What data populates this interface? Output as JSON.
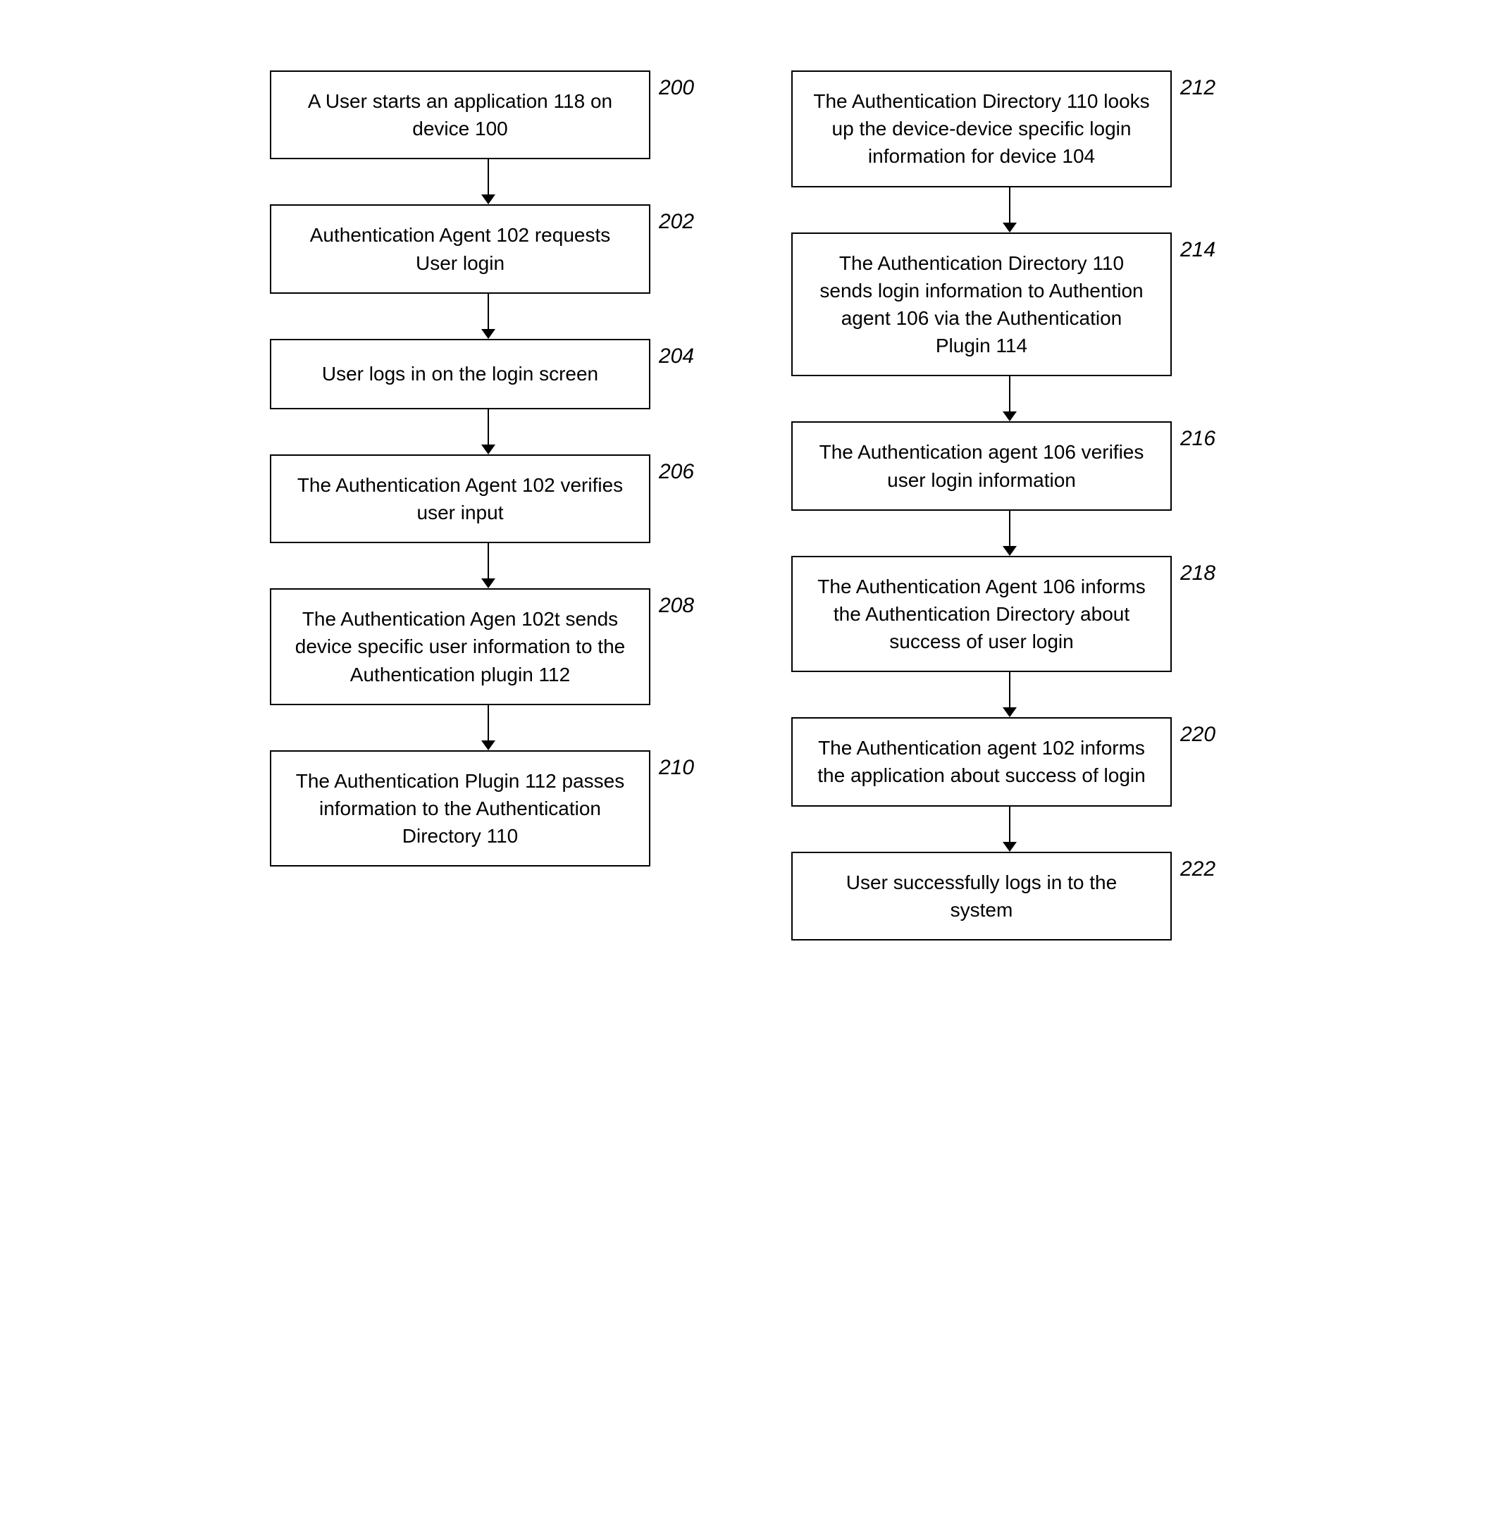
{
  "left_column": {
    "steps": [
      {
        "id": "200",
        "text": "A User starts an application 118 on device 100",
        "label": "200"
      },
      {
        "id": "202",
        "text": "Authentication Agent 102 requests User login",
        "label": "202"
      },
      {
        "id": "204",
        "text": "User logs in on the login screen",
        "label": "204"
      },
      {
        "id": "206",
        "text": "The Authentication Agent 102 verifies user input",
        "label": "206"
      },
      {
        "id": "208",
        "text": "The Authentication Agen 102t sends device specific user information to the Authentication plugin 112",
        "label": "208"
      },
      {
        "id": "210",
        "text": "The Authentication Plugin 112 passes information to the Authentication Directory 110",
        "label": "210"
      }
    ]
  },
  "right_column": {
    "steps": [
      {
        "id": "212",
        "text": "The Authentication Directory 110 looks up the device-device specific login information for device 104",
        "label": "212"
      },
      {
        "id": "214",
        "text": "The Authentication Directory 110 sends login information to Authention agent 106 via the Authentication Plugin 114",
        "label": "214"
      },
      {
        "id": "216",
        "text": "The Authentication agent 106 verifies user login information",
        "label": "216"
      },
      {
        "id": "218",
        "text": "The Authentication Agent 106 informs the Authentication Directory about success of user login",
        "label": "218"
      },
      {
        "id": "220",
        "text": "The Authentication agent 102 informs the application about success of login",
        "label": "220"
      },
      {
        "id": "222",
        "text": "User successfully logs in to the system",
        "label": "222"
      }
    ]
  }
}
